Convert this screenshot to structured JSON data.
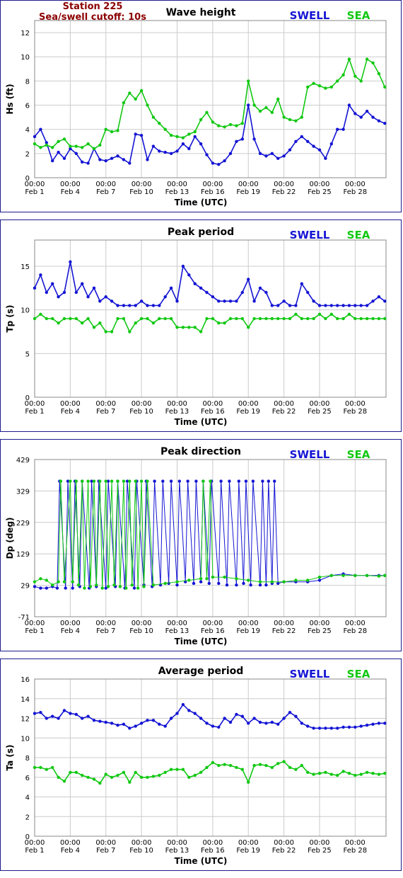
{
  "header": {
    "station": "Station 225",
    "cutoff": "Sea/swell cutoff: 10s"
  },
  "legend": {
    "swell_label": "SWELL",
    "sea_label": "SEA"
  },
  "colors": {
    "swell": "#1414d4",
    "sea": "#11c811",
    "frame": "#1c1c8c",
    "grid": "#cccccc",
    "station": "#8b0000"
  },
  "x_ticks": {
    "time": [
      "00:00",
      "00:00",
      "00:00",
      "00:00",
      "00:00",
      "00:00",
      "00:00",
      "00:00",
      "00:00",
      "00:00"
    ],
    "date": [
      "Feb 1",
      "Feb 4",
      "Feb 7",
      "Feb 10",
      "Feb 13",
      "Feb 16",
      "Feb 19",
      "Feb 22",
      "Feb 25",
      "Feb 28"
    ]
  },
  "chart_data": [
    {
      "type": "scatter",
      "title": "Wave height",
      "xlabel": "Time (UTC)",
      "ylabel": "Hs (ft)",
      "xlim": [
        0,
        29.6
      ],
      "ylim": [
        0,
        13
      ],
      "yticks": [
        0,
        2,
        4,
        6,
        8,
        10,
        12
      ],
      "grid": true,
      "legend": "top-right",
      "series": [
        {
          "name": "SWELL",
          "x": [
            0,
            0.5,
            1,
            1.5,
            2,
            2.5,
            3,
            3.5,
            4,
            4.5,
            5,
            5.5,
            6,
            6.5,
            7,
            7.5,
            8,
            8.5,
            9,
            9.5,
            10,
            10.5,
            11,
            11.5,
            12,
            12.5,
            13,
            13.5,
            14,
            14.5,
            15,
            15.5,
            16,
            16.5,
            17,
            17.5,
            18,
            18.5,
            19,
            19.5,
            20,
            20.5,
            21,
            21.5,
            22,
            22.5,
            23,
            23.5,
            24,
            24.5,
            25,
            25.5,
            26,
            26.5,
            27,
            27.5,
            28,
            28.5,
            29,
            29.5
          ],
          "values": [
            3.4,
            4.0,
            2.9,
            1.4,
            2.1,
            1.6,
            2.4,
            2.0,
            1.3,
            1.2,
            2.4,
            1.5,
            1.4,
            1.6,
            1.8,
            1.5,
            1.2,
            3.6,
            3.5,
            1.5,
            2.6,
            2.2,
            2.1,
            2.0,
            2.2,
            2.8,
            2.4,
            3.4,
            2.8,
            1.9,
            1.2,
            1.1,
            1.4,
            2.0,
            3.0,
            3.2,
            6.0,
            3.2,
            2.0,
            1.8,
            2.0,
            1.6,
            1.8,
            2.3,
            3.0,
            3.4,
            3.0,
            2.6,
            2.3,
            1.6,
            2.8,
            4.0,
            4.0,
            6.0,
            5.3,
            5.0,
            5.5,
            5.0,
            4.7,
            4.5
          ]
        },
        {
          "name": "SEA",
          "x": [
            0,
            0.5,
            1,
            1.5,
            2,
            2.5,
            3,
            3.5,
            4,
            4.5,
            5,
            5.5,
            6,
            6.5,
            7,
            7.5,
            8,
            8.5,
            9,
            9.5,
            10,
            10.5,
            11,
            11.5,
            12,
            12.5,
            13,
            13.5,
            14,
            14.5,
            15,
            15.5,
            16,
            16.5,
            17,
            17.5,
            18,
            18.5,
            19,
            19.5,
            20,
            20.5,
            21,
            21.5,
            22,
            22.5,
            23,
            23.5,
            24,
            24.5,
            25,
            25.5,
            26,
            26.5,
            27,
            27.5,
            28,
            28.5,
            29,
            29.5
          ],
          "values": [
            2.8,
            2.5,
            2.7,
            2.5,
            3.0,
            3.2,
            2.6,
            2.6,
            2.5,
            2.8,
            2.4,
            2.7,
            4.0,
            3.8,
            3.9,
            6.2,
            7.0,
            6.5,
            7.2,
            6.0,
            5.0,
            4.5,
            4.0,
            3.5,
            3.4,
            3.3,
            3.6,
            3.8,
            4.8,
            5.4,
            4.6,
            4.3,
            4.2,
            4.4,
            4.3,
            4.5,
            8.0,
            6.0,
            5.5,
            5.8,
            5.4,
            6.5,
            5.0,
            4.8,
            4.7,
            5.0,
            7.5,
            7.8,
            7.6,
            7.4,
            7.5,
            8.0,
            8.5,
            9.8,
            8.4,
            8.0,
            9.8,
            9.5,
            8.6,
            7.5
          ]
        }
      ]
    },
    {
      "type": "scatter",
      "title": "Peak period",
      "xlabel": "Time (UTC)",
      "ylabel": "Tp (s)",
      "xlim": [
        0,
        29.6
      ],
      "ylim": [
        0,
        18
      ],
      "yticks": [
        0,
        5,
        10,
        15
      ],
      "grid": true,
      "legend": "top-right",
      "series": [
        {
          "name": "SWELL",
          "x": [
            0,
            0.5,
            1,
            1.5,
            2,
            2.5,
            3,
            3.5,
            4,
            4.5,
            5,
            5.5,
            6,
            6.5,
            7,
            7.5,
            8,
            8.5,
            9,
            9.5,
            10,
            10.5,
            11,
            11.5,
            12,
            12.5,
            13,
            13.5,
            14,
            14.5,
            15,
            15.5,
            16,
            16.5,
            17,
            17.5,
            18,
            18.5,
            19,
            19.5,
            20,
            20.5,
            21,
            21.5,
            22,
            22.5,
            23,
            23.5,
            24,
            24.5,
            25,
            25.5,
            26,
            26.5,
            27,
            27.5,
            28,
            28.5,
            29,
            29.5
          ],
          "values": [
            12.5,
            14.0,
            12.0,
            13.0,
            11.5,
            12.0,
            15.5,
            12.0,
            13.0,
            11.5,
            12.5,
            11.0,
            11.5,
            11.0,
            10.5,
            10.5,
            10.5,
            10.5,
            11.0,
            10.5,
            10.5,
            10.5,
            11.5,
            12.5,
            11.0,
            15.0,
            14.0,
            13.0,
            12.5,
            12.0,
            11.5,
            11.0,
            11.0,
            11.0,
            11.0,
            12.0,
            13.5,
            11.0,
            12.5,
            12.0,
            10.5,
            10.5,
            11.0,
            10.5,
            10.5,
            13.0,
            12.0,
            11.0,
            10.5,
            10.5,
            10.5,
            10.5,
            10.5,
            10.5,
            10.5,
            10.5,
            10.5,
            11.0,
            11.5,
            11.0
          ]
        },
        {
          "name": "SEA",
          "x": [
            0,
            0.5,
            1,
            1.5,
            2,
            2.5,
            3,
            3.5,
            4,
            4.5,
            5,
            5.5,
            6,
            6.5,
            7,
            7.5,
            8,
            8.5,
            9,
            9.5,
            10,
            10.5,
            11,
            11.5,
            12,
            12.5,
            13,
            13.5,
            14,
            14.5,
            15,
            15.5,
            16,
            16.5,
            17,
            17.5,
            18,
            18.5,
            19,
            19.5,
            20,
            20.5,
            21,
            21.5,
            22,
            22.5,
            23,
            23.5,
            24,
            24.5,
            25,
            25.5,
            26,
            26.5,
            27,
            27.5,
            28,
            28.5,
            29,
            29.5
          ],
          "values": [
            9.0,
            9.5,
            9.0,
            9.0,
            8.5,
            9.0,
            9.0,
            9.0,
            8.5,
            9.0,
            8.0,
            8.5,
            7.5,
            7.5,
            9.0,
            9.0,
            7.5,
            8.5,
            9.0,
            9.0,
            8.5,
            9.0,
            9.0,
            9.0,
            8.0,
            8.0,
            8.0,
            8.0,
            7.5,
            9.0,
            9.0,
            8.5,
            8.5,
            9.0,
            9.0,
            9.0,
            8.0,
            9.0,
            9.0,
            9.0,
            9.0,
            9.0,
            9.0,
            9.0,
            9.5,
            9.0,
            9.0,
            9.0,
            9.5,
            9.0,
            9.5,
            9.0,
            9.0,
            9.5,
            9.0,
            9.0,
            9.0,
            9.0,
            9.0,
            9.0
          ]
        }
      ]
    },
    {
      "type": "line",
      "title": "Peak direction",
      "xlabel": "Time (UTC)",
      "ylabel": "Dp (deg)",
      "xlim": [
        0,
        29.6
      ],
      "ylim": [
        -71,
        429
      ],
      "yticks": [
        -71,
        29,
        129,
        229,
        329,
        429
      ],
      "grid": true,
      "legend": "top-right",
      "series": [
        {
          "name": "SWELL",
          "x": [
            0,
            0.5,
            1,
            1.5,
            1.9,
            2.1,
            2.6,
            2.8,
            3.2,
            3.4,
            3.8,
            4.0,
            4.6,
            4.8,
            5.2,
            5.4,
            6.0,
            6.2,
            6.8,
            7.0,
            7.6,
            7.8,
            8.4,
            8.6,
            9.2,
            9.4,
            9.9,
            10.1,
            10.6,
            10.8,
            11.3,
            11.5,
            12.0,
            12.2,
            12.7,
            12.9,
            13.4,
            13.6,
            14.0,
            14.2,
            14.7,
            14.9,
            15.5,
            15.7,
            16.2,
            16.4,
            17.0,
            17.2,
            17.6,
            17.8,
            18.2,
            18.4,
            19.0,
            19.2,
            19.5,
            19.7,
            20.0,
            20.2,
            20.5,
            21,
            22,
            23,
            24,
            25,
            26,
            27,
            28,
            29,
            29.5
          ],
          "values": [
            25,
            20,
            20,
            25,
            20,
            360,
            20,
            360,
            20,
            360,
            25,
            360,
            20,
            360,
            25,
            360,
            20,
            360,
            25,
            360,
            20,
            360,
            20,
            360,
            30,
            360,
            25,
            360,
            30,
            360,
            35,
            360,
            30,
            360,
            40,
            360,
            35,
            360,
            40,
            360,
            35,
            360,
            35,
            360,
            30,
            360,
            30,
            360,
            35,
            360,
            30,
            360,
            30,
            360,
            30,
            360,
            35,
            360,
            35,
            40,
            40,
            40,
            45,
            60,
            65,
            60,
            60,
            60,
            60
          ]
        },
        {
          "name": "SEA",
          "x": [
            0,
            0.5,
            1,
            1.5,
            2,
            2.2,
            2.5,
            3.0,
            3.2,
            3.5,
            3.7,
            4.0,
            4.2,
            4.5,
            4.7,
            5.0,
            5.2,
            5.5,
            5.7,
            6.0,
            6.2,
            6.5,
            6.7,
            7.0,
            7.2,
            7.5,
            7.7,
            8.0,
            8.2,
            8.5,
            8.7,
            9.0,
            9.2,
            9.5,
            10,
            11,
            12,
            13,
            14,
            14.2,
            14.5,
            14.8,
            15,
            16,
            17,
            18,
            19,
            20,
            21,
            22,
            23,
            24,
            25,
            26,
            27,
            28,
            29,
            29.5
          ],
          "values": [
            40,
            50,
            45,
            30,
            40,
            360,
            40,
            360,
            40,
            360,
            30,
            360,
            20,
            360,
            25,
            360,
            30,
            360,
            20,
            360,
            25,
            360,
            30,
            360,
            25,
            360,
            20,
            360,
            30,
            360,
            20,
            360,
            25,
            360,
            30,
            35,
            40,
            45,
            50,
            360,
            50,
            360,
            55,
            55,
            50,
            45,
            40,
            40,
            40,
            45,
            45,
            55,
            60,
            60,
            60,
            60,
            58,
            60
          ]
        }
      ]
    },
    {
      "type": "scatter",
      "title": "Average period",
      "xlabel": "Time (UTC)",
      "ylabel": "Ta (s)",
      "xlim": [
        0,
        29.6
      ],
      "ylim": [
        0,
        16
      ],
      "yticks": [
        0,
        2,
        4,
        6,
        8,
        10,
        12,
        14,
        16
      ],
      "grid": true,
      "legend": "top-right",
      "series": [
        {
          "name": "SWELL",
          "x": [
            0,
            0.5,
            1,
            1.5,
            2,
            2.5,
            3,
            3.5,
            4,
            4.5,
            5,
            5.5,
            6,
            6.5,
            7,
            7.5,
            8,
            8.5,
            9,
            9.5,
            10,
            10.5,
            11,
            11.5,
            12,
            12.5,
            13,
            13.5,
            14,
            14.5,
            15,
            15.5,
            16,
            16.5,
            17,
            17.5,
            18,
            18.5,
            19,
            19.5,
            20,
            20.5,
            21,
            21.5,
            22,
            22.5,
            23,
            23.5,
            24,
            24.5,
            25,
            25.5,
            26,
            26.5,
            27,
            27.5,
            28,
            28.5,
            29,
            29.5
          ],
          "values": [
            12.5,
            12.6,
            12.0,
            12.2,
            12.0,
            12.8,
            12.5,
            12.4,
            12.0,
            12.2,
            11.8,
            11.7,
            11.6,
            11.5,
            11.3,
            11.4,
            11.0,
            11.2,
            11.5,
            11.8,
            11.8,
            11.4,
            11.2,
            12.0,
            12.5,
            13.4,
            12.8,
            12.5,
            12.0,
            11.5,
            11.2,
            11.1,
            12.0,
            11.6,
            12.4,
            12.2,
            11.5,
            12.0,
            11.6,
            11.5,
            11.6,
            11.4,
            12.0,
            12.6,
            12.2,
            11.5,
            11.2,
            11.0,
            11.0,
            11.0,
            11.0,
            11.0,
            11.1,
            11.1,
            11.1,
            11.2,
            11.3,
            11.4,
            11.5,
            11.5
          ]
        },
        {
          "name": "SEA",
          "x": [
            0,
            0.5,
            1,
            1.5,
            2,
            2.5,
            3,
            3.5,
            4,
            4.5,
            5,
            5.5,
            6,
            6.5,
            7,
            7.5,
            8,
            8.5,
            9,
            9.5,
            10,
            10.5,
            11,
            11.5,
            12,
            12.5,
            13,
            13.5,
            14,
            14.5,
            15,
            15.5,
            16,
            16.5,
            17,
            17.5,
            18,
            18.5,
            19,
            19.5,
            20,
            20.5,
            21,
            21.5,
            22,
            22.5,
            23,
            23.5,
            24,
            24.5,
            25,
            25.5,
            26,
            26.5,
            27,
            27.5,
            28,
            28.5,
            29,
            29.5
          ],
          "values": [
            7.0,
            7.0,
            6.8,
            7.0,
            6.0,
            5.6,
            6.5,
            6.5,
            6.2,
            6.0,
            5.8,
            5.4,
            6.3,
            6.0,
            6.2,
            6.5,
            5.5,
            6.5,
            6.0,
            6.0,
            6.1,
            6.2,
            6.5,
            6.8,
            6.8,
            6.8,
            6.0,
            6.2,
            6.5,
            7.0,
            7.5,
            7.2,
            7.3,
            7.2,
            7.0,
            6.8,
            5.5,
            7.2,
            7.3,
            7.2,
            7.0,
            7.4,
            7.6,
            7.0,
            6.8,
            7.2,
            6.5,
            6.3,
            6.4,
            6.5,
            6.3,
            6.2,
            6.6,
            6.4,
            6.2,
            6.3,
            6.5,
            6.4,
            6.3,
            6.4
          ]
        }
      ]
    }
  ]
}
